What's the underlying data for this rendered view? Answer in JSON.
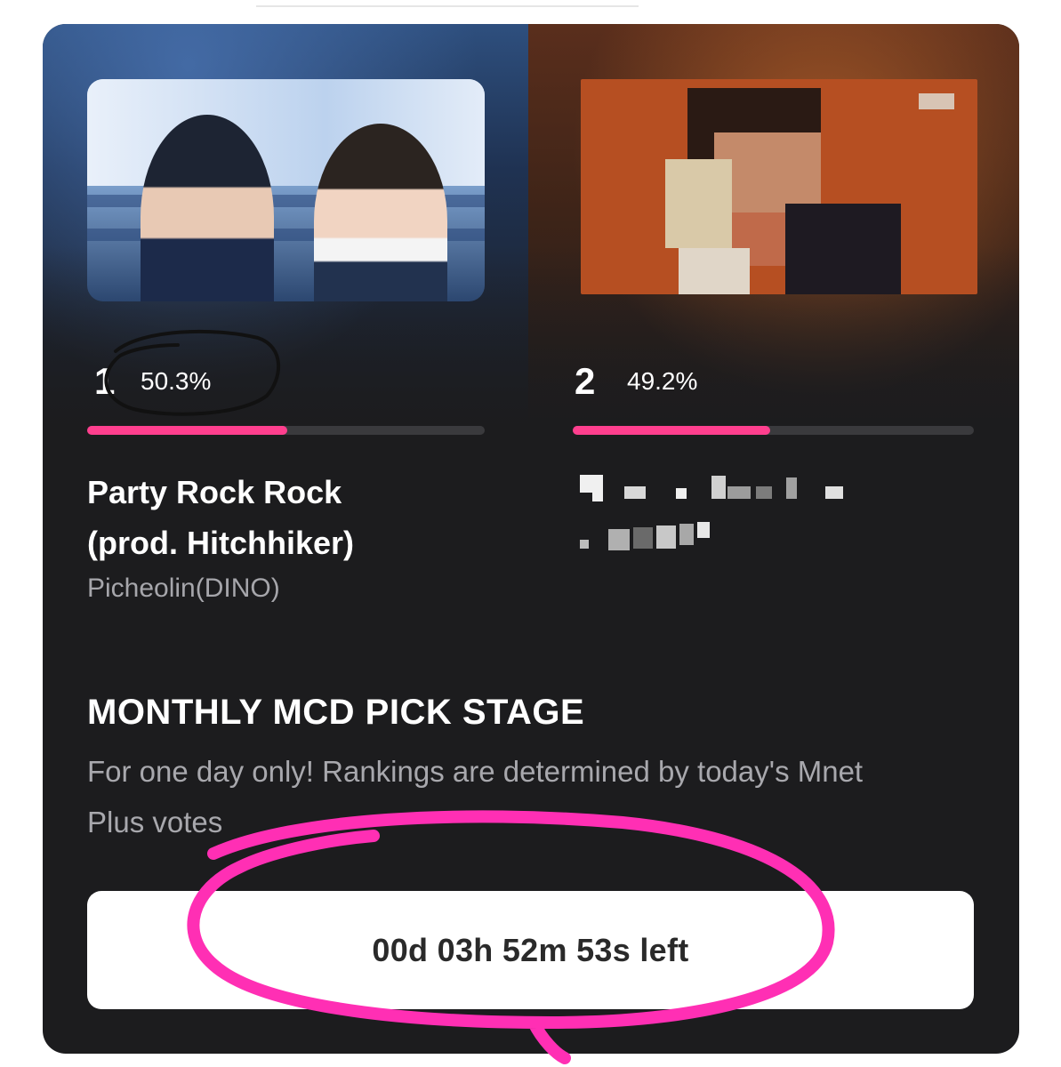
{
  "matchup": {
    "left": {
      "rank": "1",
      "percent": "50.3%",
      "share": 0.503,
      "song_title_line1": "Party Rock Rock",
      "song_title_line2": "(prod. Hitchhiker)",
      "artist": "Picheolin(DINO)"
    },
    "right": {
      "rank": "2",
      "percent": "49.2%",
      "share": 0.492
    }
  },
  "section": {
    "title": "MONTHLY MCD PICK STAGE",
    "description": "For one day only! Rankings are determined by today's Mnet Plus votes"
  },
  "timer": {
    "label": "00d 03h 52m 53s left"
  },
  "colors": {
    "accent_pink": "#ff3f8e",
    "card_bg": "#1c1c1e",
    "annotation_pink": "#ff2fb4",
    "annotation_black": "#111111"
  }
}
